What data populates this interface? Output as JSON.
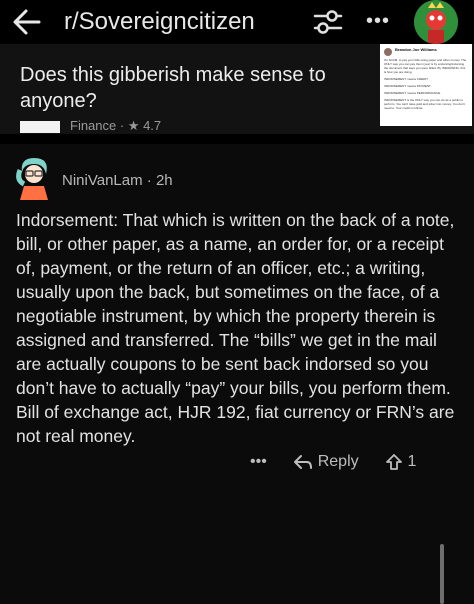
{
  "header": {
    "subreddit": "r/Sovereigncitizen",
    "back_icon": "arrow-left-icon",
    "filter_icon": "sliders-icon",
    "more_icon": "more-horizontal-icon",
    "more_text": "•••"
  },
  "post": {
    "title": "Does this gibberish make sense to anyone?",
    "meta_text": "Finance  · ★ 4.7",
    "thumbnail": {
      "author": "Brandon Joe Williams",
      "lines": [
        "It's SCAM, to pay your bills using paper and other money. The ONLY way you can pay them (yes) is by endorsing/indorsing the document that says you were billed. By INDORSING, this is how you are doing.",
        "INDORSEMENT means CREDIT.",
        "INDORSEMENT means PAYMENT.",
        "INDORSEMENT means PERFORMANCE.",
        "INDORSEMENT is the ONLY way you can do as a public to perform. You can't raise gold and silver into money. You don't need to. Your credit is infinite."
      ]
    }
  },
  "comment": {
    "author": "NiniVanLam",
    "separator": "·",
    "age": "2h",
    "body": "Indorsement: That which is written on the back of a note, bill, or other paper, as a name, an order for, or a receipt of, payment, or the return of an officer, etc.; a writing, usually upon the back, but sometimes on the face, of a negotiable instrument, by which the property therein is assigned and transferred. The “bills” we get in the mail are actually coupons to be sent back indorsed so you don’t have to actually “pay” your bills, you perform them. Bill of exchange act, HJR 192, fiat currency or FRN’s are not real money.",
    "actions": {
      "more": "•••",
      "reply": "Reply",
      "vote_count": "1"
    }
  },
  "colors": {
    "background": "#0b0b0b",
    "card": "#121212",
    "text": "#e2e2e2",
    "muted": "#b8b8b8"
  }
}
